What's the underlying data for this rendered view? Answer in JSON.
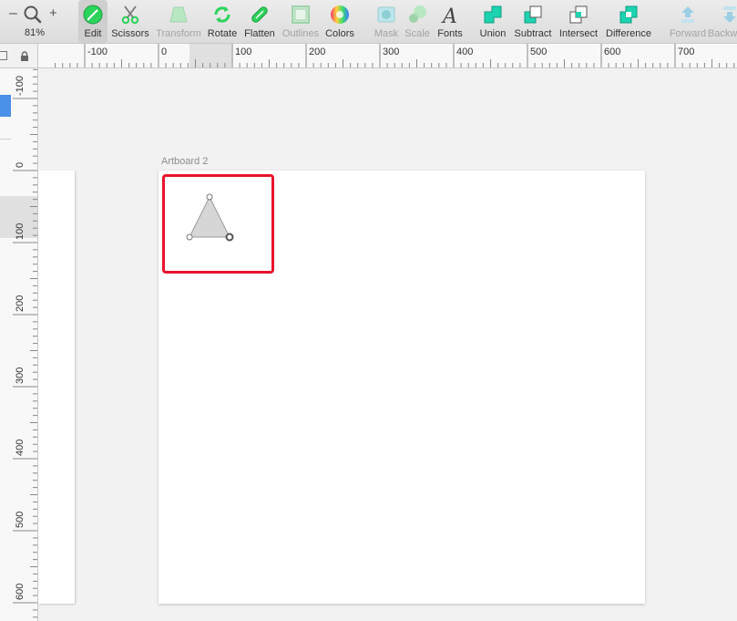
{
  "toolbar": {
    "zoom": {
      "minus": "–",
      "plus": "+",
      "value": "81%"
    },
    "tools": [
      {
        "label": "Edit",
        "icon": "edit-icon",
        "state": "active"
      },
      {
        "label": "Scissors",
        "icon": "scissors-icon",
        "state": "enabled"
      },
      {
        "label": "Transform",
        "icon": "transform-icon",
        "state": "disabled"
      },
      {
        "label": "Rotate",
        "icon": "rotate-icon",
        "state": "enabled"
      },
      {
        "label": "Flatten",
        "icon": "flatten-icon",
        "state": "enabled"
      },
      {
        "label": "Outlines",
        "icon": "outlines-icon",
        "state": "disabled"
      },
      {
        "label": "Colors",
        "icon": "colors-icon",
        "state": "enabled"
      },
      {
        "label": "Mask",
        "icon": "mask-icon",
        "state": "disabled"
      },
      {
        "label": "Scale",
        "icon": "scale-icon",
        "state": "disabled"
      },
      {
        "label": "Fonts",
        "icon": "fonts-icon",
        "state": "enabled"
      },
      {
        "label": "Union",
        "icon": "union-icon",
        "state": "enabled"
      },
      {
        "label": "Subtract",
        "icon": "subtract-icon",
        "state": "enabled"
      },
      {
        "label": "Intersect",
        "icon": "intersect-icon",
        "state": "enabled"
      },
      {
        "label": "Difference",
        "icon": "difference-icon",
        "state": "enabled"
      },
      {
        "label": "Forward",
        "icon": "forward-icon",
        "state": "disabled"
      },
      {
        "label": "Backward",
        "icon": "backward-icon",
        "state": "disabled"
      }
    ]
  },
  "rulers": {
    "horizontal": [
      "-100",
      "0",
      "100",
      "200",
      "300",
      "400",
      "500",
      "600",
      "700"
    ],
    "vertical": [
      "-100",
      "0",
      "100",
      "200",
      "300",
      "400",
      "500",
      "600"
    ]
  },
  "canvas": {
    "artboard_label": "Artboard 2"
  },
  "colors": {
    "accent_green": "#2bd35a",
    "boolean_teal": "#1dd3b0",
    "selection_red": "#e8132c",
    "sidebar_blue": "#4a8fe8",
    "shape_fill": "#d6d6d6"
  }
}
